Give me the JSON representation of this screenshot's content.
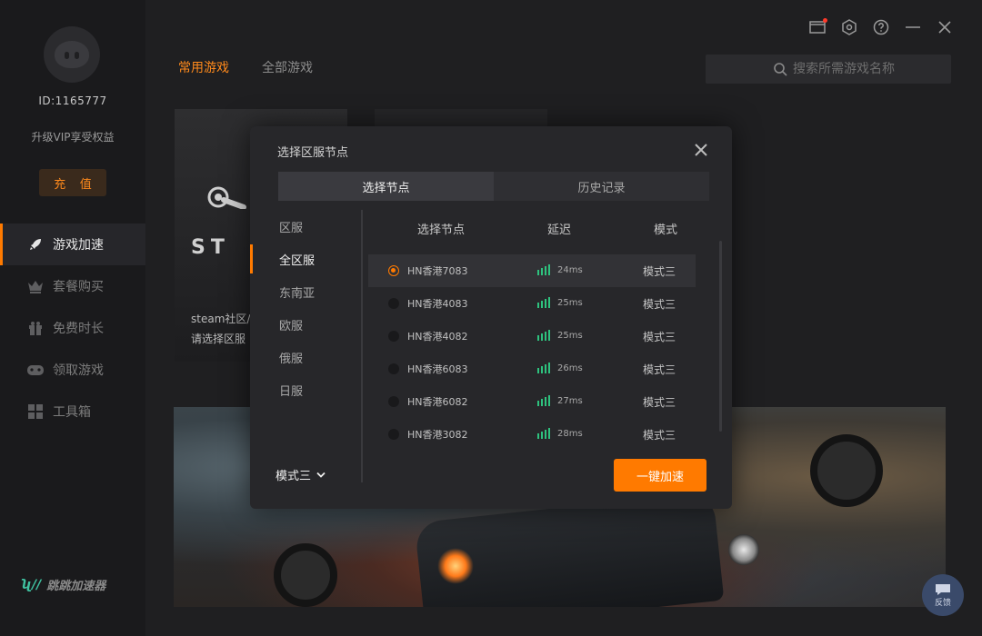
{
  "user": {
    "id": "ID:1165777",
    "vip_promo": "升级VIP享受权益",
    "recharge_label": "充 值"
  },
  "sidebar": {
    "items": [
      {
        "label": "游戏加速",
        "icon": "rocket-icon"
      },
      {
        "label": "套餐购买",
        "icon": "crown-icon"
      },
      {
        "label": "免费时长",
        "icon": "gift-icon"
      },
      {
        "label": "领取游戏",
        "icon": "gamepad-icon"
      },
      {
        "label": "工具箱",
        "icon": "toolbox-icon"
      }
    ],
    "active_index": 0,
    "brand": "跳跳加速器"
  },
  "header": {
    "tabs": [
      "常用游戏",
      "全部游戏"
    ],
    "search_placeholder": "搜索所需游戏名称"
  },
  "game_card": {
    "title": "ST",
    "desc_line1": "steam社区/",
    "desc_line2": "请选择区服"
  },
  "feedback_label": "反馈",
  "modal": {
    "title": "选择区服节点",
    "tabs": [
      "选择节点",
      "历史记录"
    ],
    "regions": [
      "区服",
      "全区服",
      "东南亚",
      "欧服",
      "俄服",
      "日服"
    ],
    "active_region_index": 1,
    "columns": {
      "node": "选择节点",
      "latency": "延迟",
      "mode": "模式"
    },
    "nodes": [
      {
        "name": "HN香港7083",
        "latency": "24ms",
        "mode": "模式三",
        "selected": true
      },
      {
        "name": "HN香港4083",
        "latency": "25ms",
        "mode": "模式三",
        "selected": false
      },
      {
        "name": "HN香港4082",
        "latency": "25ms",
        "mode": "模式三",
        "selected": false
      },
      {
        "name": "HN香港6083",
        "latency": "26ms",
        "mode": "模式三",
        "selected": false
      },
      {
        "name": "HN香港6082",
        "latency": "27ms",
        "mode": "模式三",
        "selected": false
      },
      {
        "name": "HN香港3082",
        "latency": "28ms",
        "mode": "模式三",
        "selected": false
      }
    ],
    "mode_select": "模式三",
    "accelerate_button": "一键加速"
  },
  "colors": {
    "accent": "#ff7a00",
    "signal": "#2ec27e",
    "background": "#1f1f21"
  }
}
